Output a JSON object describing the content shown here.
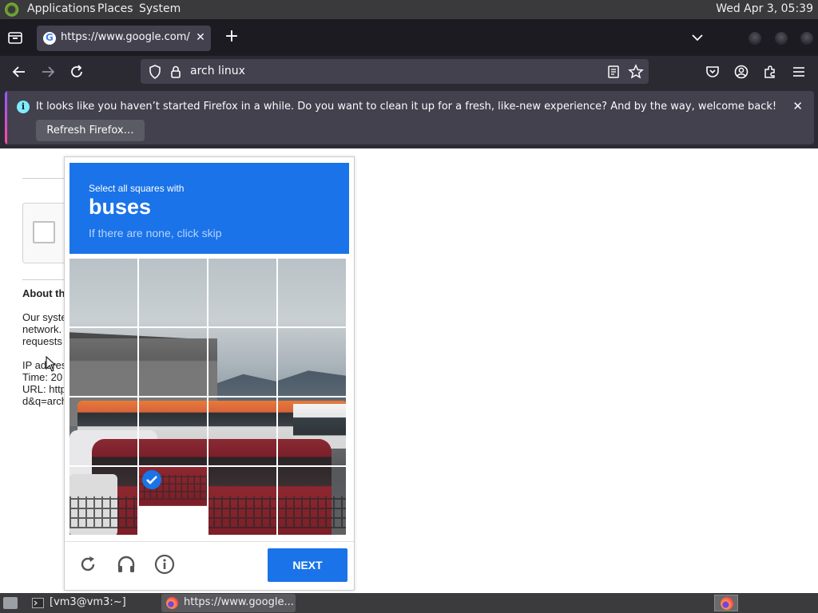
{
  "top_panel": {
    "menus": [
      "Applications",
      "Places",
      "System"
    ],
    "clock": "Wed Apr  3, 05:39"
  },
  "browser": {
    "tab": {
      "title": "https://www.google.com/sorry/index?continue"
    },
    "address_bar": {
      "value": "arch linux"
    },
    "notification": {
      "message": "It looks like you haven’t started Firefox in a while. Do you want to clean it up for a fresh, like-new experience? And by the way, welcome back!",
      "button_label": "Refresh Firefox…"
    }
  },
  "page": {
    "about_heading": "About th",
    "body_lines": [
      "Our syste",
      "network.",
      "requests"
    ],
    "info_lines": [
      "IP addres",
      "Time: 20",
      "URL: http",
      "d&q=arch"
    ]
  },
  "captcha": {
    "instruction": "Select all squares with",
    "keyword": "buses",
    "hint": "If there are none, click skip",
    "tiles": [
      {
        "row": 0,
        "col": 0,
        "selected": false
      },
      {
        "row": 0,
        "col": 1,
        "selected": false
      },
      {
        "row": 0,
        "col": 2,
        "selected": false
      },
      {
        "row": 0,
        "col": 3,
        "selected": false
      },
      {
        "row": 1,
        "col": 0,
        "selected": false
      },
      {
        "row": 1,
        "col": 1,
        "selected": false
      },
      {
        "row": 1,
        "col": 2,
        "selected": false
      },
      {
        "row": 1,
        "col": 3,
        "selected": false
      },
      {
        "row": 2,
        "col": 0,
        "selected": false
      },
      {
        "row": 2,
        "col": 1,
        "selected": false
      },
      {
        "row": 2,
        "col": 2,
        "selected": false
      },
      {
        "row": 2,
        "col": 3,
        "selected": false
      },
      {
        "row": 3,
        "col": 0,
        "selected": false
      },
      {
        "row": 3,
        "col": 1,
        "selected": true
      },
      {
        "row": 3,
        "col": 2,
        "selected": false
      },
      {
        "row": 3,
        "col": 3,
        "selected": false
      }
    ],
    "next_label": "NEXT"
  },
  "taskbar": {
    "tasks": [
      "[vm3@vm3:~]",
      "https://www.google..."
    ]
  },
  "colors": {
    "captcha_blue": "#1a73e8",
    "firefox_dark": "#2b2a33"
  }
}
